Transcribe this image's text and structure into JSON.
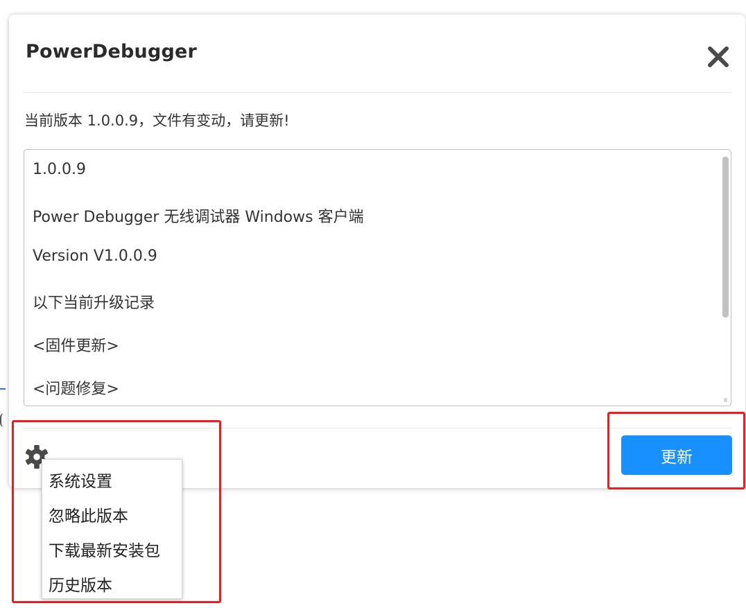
{
  "dialog": {
    "title": "PowerDebugger",
    "status": "当前版本 1.0.0.9，文件有变动，请更新!",
    "notes": [
      "1.0.0.9",
      "Power Debugger 无线调试器 Windows 客户端",
      "Version V1.0.0.9",
      "以下当前升级记录",
      "<固件更新>",
      "<问题修复>"
    ],
    "update_label": "更新",
    "close_icon": "close-icon",
    "settings_icon": "gear-icon"
  },
  "menu": {
    "items": [
      "系统设置",
      "忽略此版本",
      "下载最新安装包",
      "历史版本"
    ]
  },
  "colors": {
    "accent": "#1890ff",
    "annotation": "#ee1c1c",
    "title_text": "#2b2b2b",
    "icon_gray": "#4a4a4a"
  }
}
